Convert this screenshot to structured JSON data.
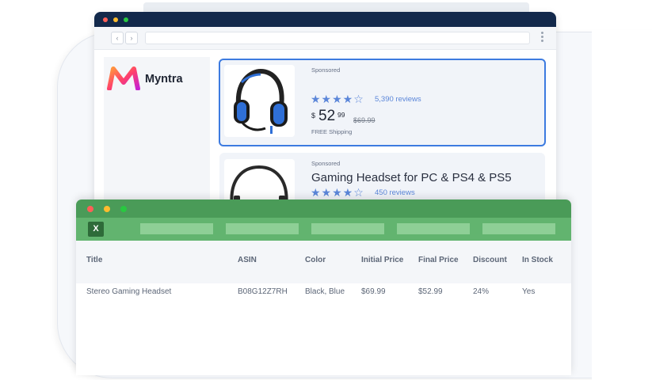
{
  "browser": {
    "logo_text": "Myntra",
    "products": [
      {
        "sponsored": "Sponsored",
        "rating_stars": 4,
        "reviews": "5,390 reviews",
        "price_symbol": "$",
        "price_main": "52",
        "price_cents": "99",
        "price_old": "$69.99",
        "shipping": "FREE Shipping"
      },
      {
        "sponsored": "Sponsored",
        "title": "Gaming Headset for PC & PS4 & PS5",
        "rating_stars": 4,
        "reviews": "450 reviews"
      }
    ]
  },
  "spreadsheet": {
    "icon_label": "X",
    "columns": [
      "Title",
      "ASIN",
      "Color",
      "Initial Price",
      "Final Price",
      "Discount",
      "In Stock"
    ],
    "rows": [
      [
        "Stereo Gaming Headset",
        "B08G12Z7RH",
        "Black, Blue",
        "$69.99",
        "$52.99",
        "24%",
        "Yes"
      ]
    ]
  },
  "colors": {
    "browser_titlebar": "#13294b",
    "selection_border": "#3d7be0",
    "star_color": "#5b86d9",
    "sheet_titlebar": "#4a9b58",
    "sheet_ribbon": "#62b46f"
  }
}
